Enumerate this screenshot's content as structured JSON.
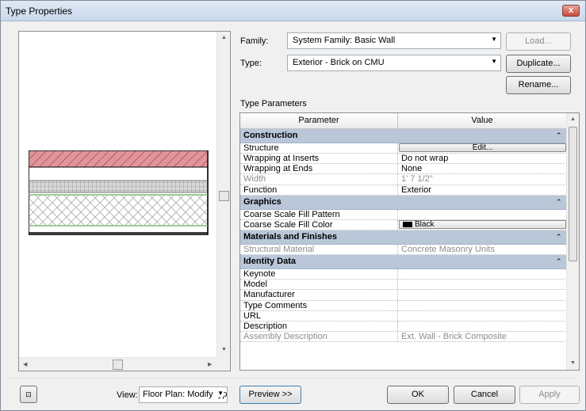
{
  "window": {
    "title": "Type Properties",
    "close_glyph": "x"
  },
  "family": {
    "label": "Family:",
    "value": "System Family: Basic Wall"
  },
  "type": {
    "label": "Type:",
    "value": "Exterior - Brick on CMU"
  },
  "buttons": {
    "load": "Load...",
    "duplicate": "Duplicate...",
    "rename": "Rename...",
    "preview": "Preview >>",
    "ok": "OK",
    "cancel": "Cancel",
    "apply": "Apply"
  },
  "type_parameters_label": "Type Parameters",
  "grid": {
    "headers": [
      "Parameter",
      "Value"
    ],
    "groups": [
      {
        "name": "Construction",
        "rows": [
          {
            "param": "Structure",
            "value": "Edit...",
            "kind": "button"
          },
          {
            "param": "Wrapping at Inserts",
            "value": "Do not wrap"
          },
          {
            "param": "Wrapping at Ends",
            "value": "None"
          },
          {
            "param": "Width",
            "value": "1'  7 1/2\"",
            "disabled": true
          },
          {
            "param": "Function",
            "value": "Exterior"
          }
        ]
      },
      {
        "name": "Graphics",
        "rows": [
          {
            "param": "Coarse Scale Fill Pattern",
            "value": ""
          },
          {
            "param": "Coarse Scale Fill Color",
            "value": "Black",
            "kind": "color"
          }
        ]
      },
      {
        "name": "Materials and Finishes",
        "rows": [
          {
            "param": "Structural Material",
            "value": "Concrete Masonry Units",
            "disabled": true
          }
        ]
      },
      {
        "name": "Identity Data",
        "rows": [
          {
            "param": "Keynote",
            "value": ""
          },
          {
            "param": "Model",
            "value": ""
          },
          {
            "param": "Manufacturer",
            "value": ""
          },
          {
            "param": "Type Comments",
            "value": ""
          },
          {
            "param": "URL",
            "value": ""
          },
          {
            "param": "Description",
            "value": ""
          },
          {
            "param": "Assembly Description",
            "value": "Ext. Wall - Brick Composite",
            "disabled": true
          }
        ]
      }
    ]
  },
  "view": {
    "label": "View:",
    "value": "Floor Plan: Modify typ"
  },
  "icons": {
    "view_2d": "2d-view-icon",
    "collapse": "collapse-chevron-icon",
    "dropdown": "dropdown-arrow-icon"
  },
  "colors": {
    "group_header": "#b9c7d9",
    "brick": "#e0959b",
    "hatch": "#a02030",
    "membrane": "#66aa55"
  }
}
